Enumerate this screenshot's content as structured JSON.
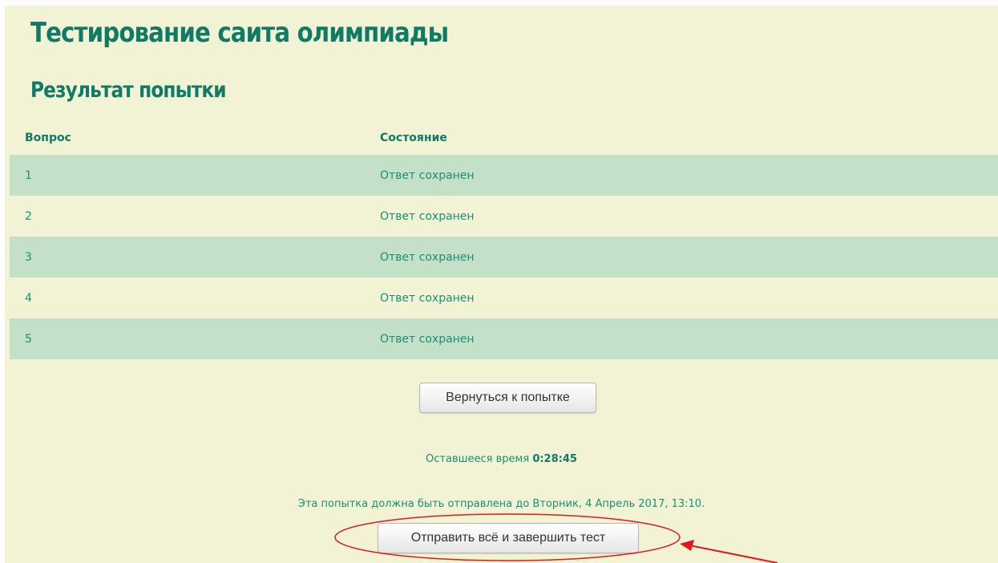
{
  "header": {
    "quiz_title": "Тестирование саита олимпиады",
    "summary_title": "Результат попытки"
  },
  "table": {
    "columns": [
      "Вопрос",
      "Состояние"
    ],
    "rows": [
      {
        "question": "1",
        "status": "Ответ сохранен"
      },
      {
        "question": "2",
        "status": "Ответ сохранен"
      },
      {
        "question": "3",
        "status": "Ответ сохранен"
      },
      {
        "question": "4",
        "status": "Ответ сохранен"
      },
      {
        "question": "5",
        "status": "Ответ сохранен"
      }
    ]
  },
  "actions": {
    "return_label": "Вернуться к попытке",
    "submit_label": "Отправить всё и завершить тест"
  },
  "timer": {
    "label": "Оставшееся время",
    "value": "0:28:45"
  },
  "deadline": {
    "text": "Эта попытка должна быть отправлена до Вторник, 4 Апрель 2017, 13:10."
  },
  "colors": {
    "page_background": "#f2f3d5",
    "row_highlight": "#c4e0c9",
    "heading": "#117a65",
    "text": "#1a8f74",
    "annotation": "#e0191e"
  },
  "annotation": {
    "type": "red-ellipse-and-arrow",
    "target": "submit-button"
  }
}
